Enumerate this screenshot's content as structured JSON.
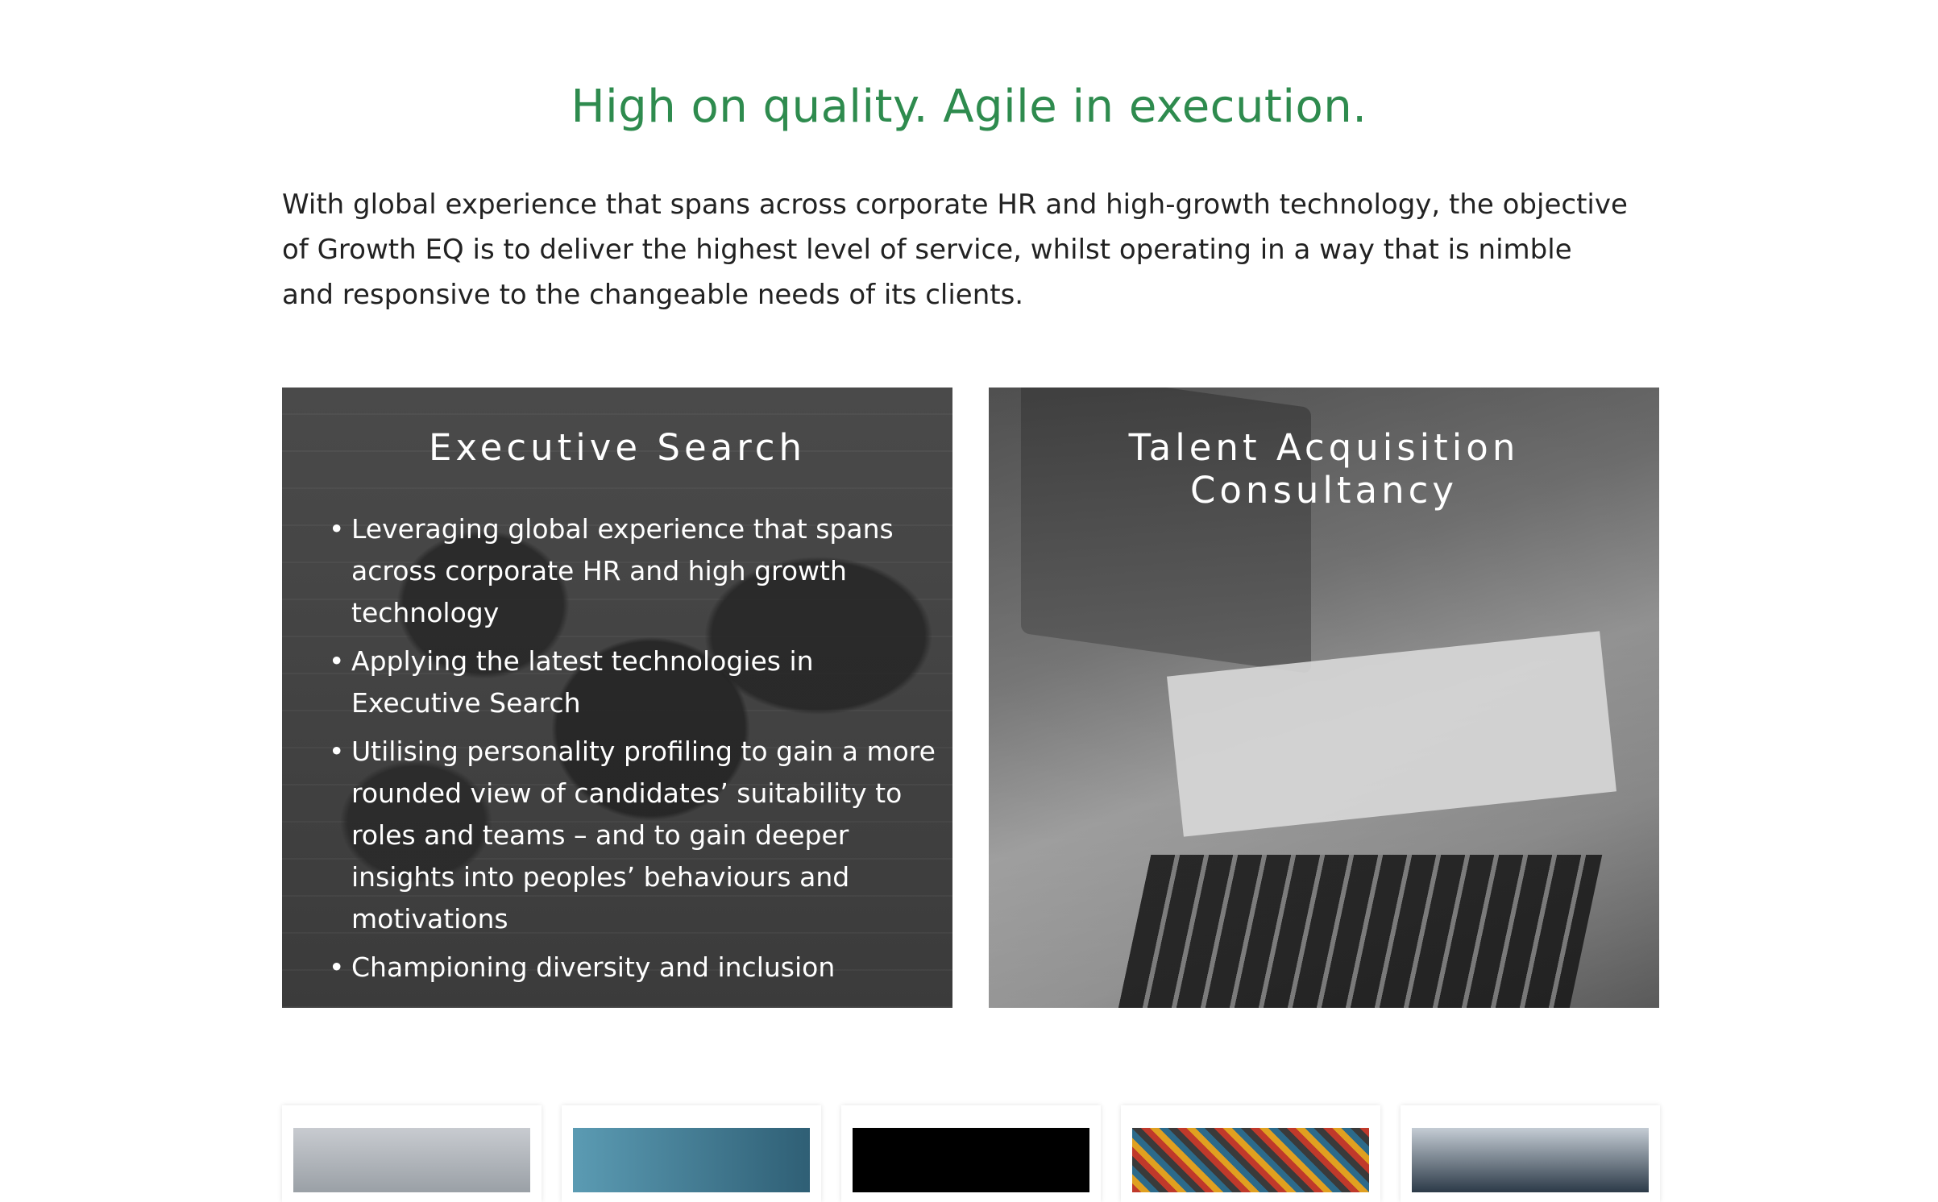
{
  "section": {
    "headline": "High on quality. Agile in execution.",
    "intro": "With  global experience that spans across  corporate  HR and high-growth technology, the objective of Growth EQ  is to deliver  the highest level of service, whilst operating in a way that is nimble  and responsive  to the changeable  needs of its clients."
  },
  "cards": [
    {
      "title": "Executive Search",
      "bullets": [
        "Leveraging global experience that spans across corporate HR and high growth technology",
        "Applying the latest technologies in Executive Search",
        "Utilising personality profiling to gain a more rounded view of candidates’ suitability to roles and teams – and to gain deeper insights into peoples’ behaviours and motivations",
        "Championing diversity and inclusion"
      ]
    },
    {
      "title": "Talent Acquisition Consultancy"
    }
  ],
  "colors": {
    "headline": "#2e8b4e",
    "body_text": "#222222"
  },
  "thumbnails": [
    {
      "name": "thumbnail-1",
      "tone": "#9aa0a6"
    },
    {
      "name": "thumbnail-2",
      "tone": "#3f7f9a"
    },
    {
      "name": "thumbnail-3",
      "tone": "#000000"
    },
    {
      "name": "thumbnail-4",
      "tone": "#a04a2a"
    },
    {
      "name": "thumbnail-5",
      "tone": "#2c3a48"
    }
  ]
}
